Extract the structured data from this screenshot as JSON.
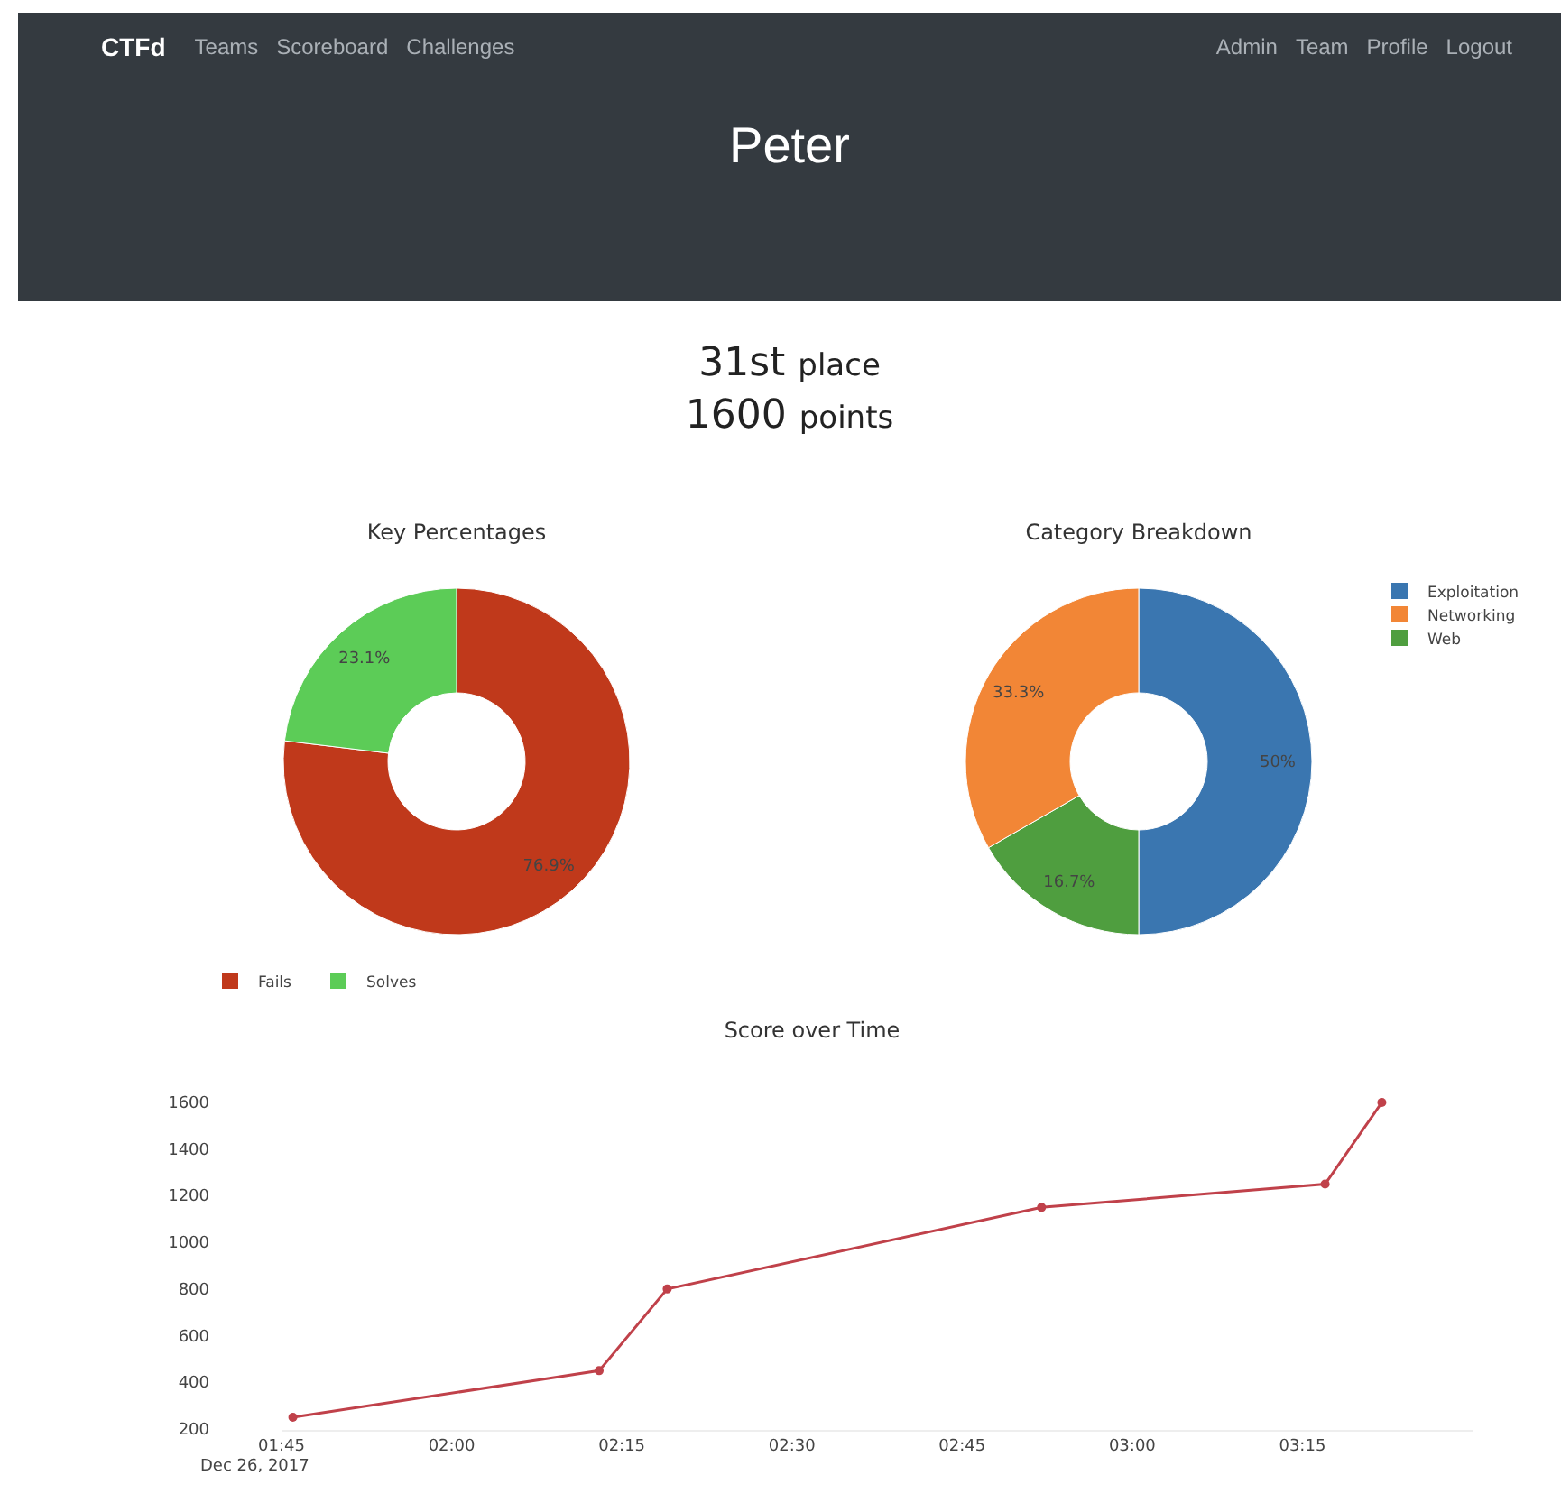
{
  "navbar": {
    "brand": "CTFd",
    "left_links": [
      "Teams",
      "Scoreboard",
      "Challenges"
    ],
    "right_links": [
      "Admin",
      "Team",
      "Profile",
      "Logout"
    ]
  },
  "header": {
    "title": "Peter"
  },
  "rank": {
    "place_number": "31st",
    "place_label": "place",
    "points_number": "1600",
    "points_label": "points"
  },
  "key_percentages": {
    "chart_data": {
      "type": "donut",
      "title": "Key Percentages",
      "categories": [
        "Fails",
        "Solves"
      ],
      "series": [
        {
          "values": [
            76.9,
            23.1
          ],
          "colors": [
            "#c0391b",
            "#5ccc57"
          ]
        }
      ],
      "value_labels": [
        "76.9%",
        "23.1%"
      ],
      "legend": "bottom"
    }
  },
  "category_breakdown": {
    "chart_data": {
      "type": "donut",
      "title": "Category Breakdown",
      "categories": [
        "Exploitation",
        "Networking",
        "Web"
      ],
      "series": [
        {
          "values": [
            50,
            33.3,
            16.7
          ],
          "colors": [
            "#3a76b0",
            "#f28636",
            "#4f9e3f"
          ]
        }
      ],
      "value_labels": [
        "50%",
        "33.3%",
        "16.7%"
      ],
      "legend": "right"
    }
  },
  "score_over_time": {
    "chart_data": {
      "type": "line",
      "title": "Score over Time",
      "x": [
        106,
        133,
        139,
        172,
        197,
        202
      ],
      "series": [
        {
          "color": "#c0414a",
          "marker": true,
          "values": [
            250,
            450,
            800,
            1150,
            1250,
            1600
          ]
        }
      ],
      "xticks": [
        {
          "value": 105,
          "label": "01:45"
        },
        {
          "value": 120,
          "label": "02:00"
        },
        {
          "value": 135,
          "label": "02:15"
        },
        {
          "value": 150,
          "label": "02:30"
        },
        {
          "value": 165,
          "label": "02:45"
        },
        {
          "value": 180,
          "label": "03:00"
        },
        {
          "value": 195,
          "label": "03:15"
        }
      ],
      "xlim": [
        105,
        210
      ],
      "ylim": [
        200,
        1600
      ],
      "annotations": [
        {
          "text": "Dec 26, 2017"
        }
      ],
      "yticks": [
        200,
        400,
        600,
        800,
        1000,
        1200,
        1400,
        1600
      ]
    }
  }
}
